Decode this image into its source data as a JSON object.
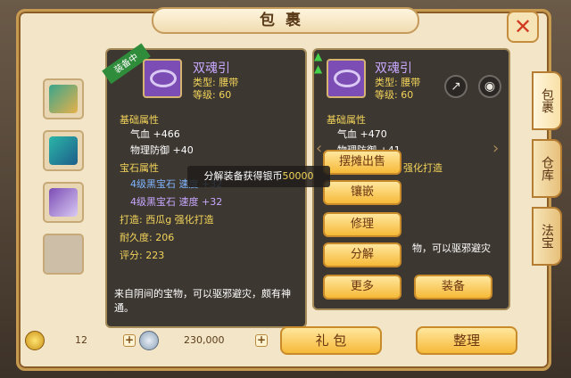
{
  "window": {
    "title": "包裹",
    "close_label": "✕"
  },
  "side_tabs": [
    {
      "label": "包裹"
    },
    {
      "label": "仓库"
    },
    {
      "label": "法宝"
    }
  ],
  "equipped_item": {
    "badge": "装备中",
    "name": "双魂引",
    "type_line": "类型: 腰带",
    "level_line": "等级: 60",
    "base_title": "基础属性",
    "base_stats": [
      "气血  +466",
      "物理防御  +40"
    ],
    "gem_title": "宝石属性",
    "gem_stats": [
      "4级黑宝石 速度 +32",
      "4级黑宝石 速度 +32"
    ],
    "forge_line": "打造: 西瓜g   强化打造",
    "durability_line": "耐久度: 206",
    "score_line": "评分: 223",
    "description": "来自阴间的宝物，可以驱邪避灾，颇有神通。"
  },
  "compare_item": {
    "name": "双魂引",
    "type_line": "类型: 腰带",
    "level_line": "等级: 60",
    "base_title": "基础属性",
    "base_stats": [
      "气血  +470",
      "物理防御  +41"
    ],
    "forge_tag": "强化打造",
    "partial_desc": "物，可以驱邪避灾"
  },
  "context_menu": [
    "摆摊出售",
    "镶嵌",
    "修理",
    "分解",
    "更多"
  ],
  "equip_button": "装备",
  "share_icon_label": "↗",
  "view_icon_label": "◉",
  "notice": {
    "prefix": "分解装备获得银币",
    "amount": "50000"
  },
  "currency": {
    "gold": "12",
    "silver": "230,000"
  },
  "bottom_buttons": {
    "gift": "礼 包",
    "arrange": "整理"
  },
  "colors": {
    "frame": "#f3e6c8",
    "accent": "#f6b938"
  }
}
